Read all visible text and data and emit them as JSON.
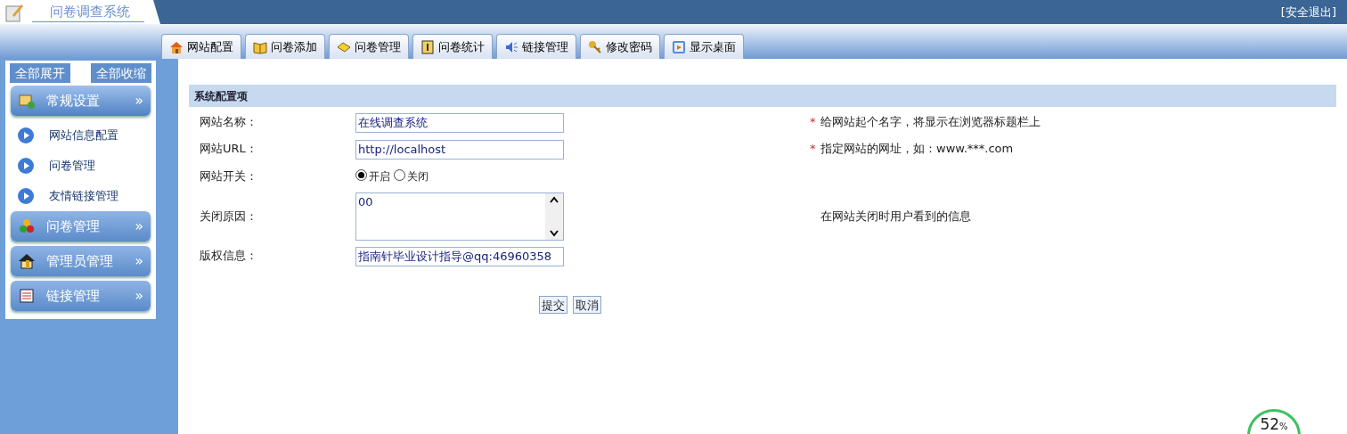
{
  "header": {
    "title": "问卷调查系统",
    "logout": "[安全退出]"
  },
  "tabs": [
    {
      "label": "网站配置"
    },
    {
      "label": "问卷添加"
    },
    {
      "label": "问卷管理"
    },
    {
      "label": "问卷统计"
    },
    {
      "label": "链接管理"
    },
    {
      "label": "修改密码"
    },
    {
      "label": "显示桌面"
    }
  ],
  "sidebar": {
    "buttons": [
      "全部展开",
      "全部收缩"
    ],
    "groups": [
      {
        "label": "常规设置",
        "chevron": "»",
        "expanded": true,
        "children": [
          {
            "label": "网站信息配置"
          },
          {
            "label": "问卷管理"
          },
          {
            "label": "友情链接管理"
          }
        ]
      },
      {
        "label": "问卷管理",
        "chevron": "»",
        "expanded": false
      },
      {
        "label": "管理员管理",
        "chevron": "»",
        "expanded": false
      },
      {
        "label": "链接管理",
        "chevron": "»",
        "expanded": false
      }
    ]
  },
  "form": {
    "title": "系统配置项",
    "rows": [
      {
        "kind": "text",
        "label": "网站名称：",
        "value": "在线调查系统",
        "marker": "*",
        "hint": "给网站起个名字，将显示在浏览器标题栏上"
      },
      {
        "kind": "text",
        "label": "网站URL：",
        "value": "http://localhost",
        "marker": "*",
        "hint": "指定网站的网址，如：www.***.com"
      },
      {
        "kind": "radio",
        "label": "网站开关：",
        "options": [
          {
            "label": "开启",
            "selected": true
          },
          {
            "label": "关闭",
            "selected": false
          }
        ]
      },
      {
        "kind": "textarea",
        "label": "关闭原因：",
        "value": "00",
        "hint": "在网站关闭时用户看到的信息"
      },
      {
        "kind": "text",
        "label": "版权信息：",
        "value": "指南针毕业设计指导@qq:46960358"
      }
    ],
    "buttons": [
      "提交",
      "取消"
    ]
  },
  "speed_ball": {
    "reading": "52",
    "unit": "%"
  }
}
